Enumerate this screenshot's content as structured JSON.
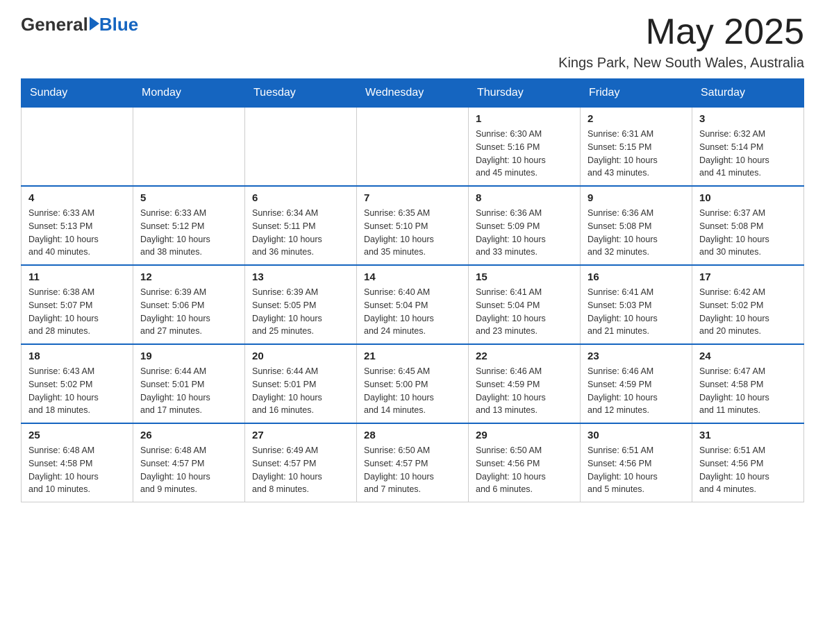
{
  "logo": {
    "text_general": "General",
    "text_blue": "Blue"
  },
  "header": {
    "month_title": "May 2025",
    "location": "Kings Park, New South Wales, Australia"
  },
  "days_of_week": [
    "Sunday",
    "Monday",
    "Tuesday",
    "Wednesday",
    "Thursday",
    "Friday",
    "Saturday"
  ],
  "weeks": [
    [
      {
        "day": "",
        "info": ""
      },
      {
        "day": "",
        "info": ""
      },
      {
        "day": "",
        "info": ""
      },
      {
        "day": "",
        "info": ""
      },
      {
        "day": "1",
        "info": "Sunrise: 6:30 AM\nSunset: 5:16 PM\nDaylight: 10 hours\nand 45 minutes."
      },
      {
        "day": "2",
        "info": "Sunrise: 6:31 AM\nSunset: 5:15 PM\nDaylight: 10 hours\nand 43 minutes."
      },
      {
        "day": "3",
        "info": "Sunrise: 6:32 AM\nSunset: 5:14 PM\nDaylight: 10 hours\nand 41 minutes."
      }
    ],
    [
      {
        "day": "4",
        "info": "Sunrise: 6:33 AM\nSunset: 5:13 PM\nDaylight: 10 hours\nand 40 minutes."
      },
      {
        "day": "5",
        "info": "Sunrise: 6:33 AM\nSunset: 5:12 PM\nDaylight: 10 hours\nand 38 minutes."
      },
      {
        "day": "6",
        "info": "Sunrise: 6:34 AM\nSunset: 5:11 PM\nDaylight: 10 hours\nand 36 minutes."
      },
      {
        "day": "7",
        "info": "Sunrise: 6:35 AM\nSunset: 5:10 PM\nDaylight: 10 hours\nand 35 minutes."
      },
      {
        "day": "8",
        "info": "Sunrise: 6:36 AM\nSunset: 5:09 PM\nDaylight: 10 hours\nand 33 minutes."
      },
      {
        "day": "9",
        "info": "Sunrise: 6:36 AM\nSunset: 5:08 PM\nDaylight: 10 hours\nand 32 minutes."
      },
      {
        "day": "10",
        "info": "Sunrise: 6:37 AM\nSunset: 5:08 PM\nDaylight: 10 hours\nand 30 minutes."
      }
    ],
    [
      {
        "day": "11",
        "info": "Sunrise: 6:38 AM\nSunset: 5:07 PM\nDaylight: 10 hours\nand 28 minutes."
      },
      {
        "day": "12",
        "info": "Sunrise: 6:39 AM\nSunset: 5:06 PM\nDaylight: 10 hours\nand 27 minutes."
      },
      {
        "day": "13",
        "info": "Sunrise: 6:39 AM\nSunset: 5:05 PM\nDaylight: 10 hours\nand 25 minutes."
      },
      {
        "day": "14",
        "info": "Sunrise: 6:40 AM\nSunset: 5:04 PM\nDaylight: 10 hours\nand 24 minutes."
      },
      {
        "day": "15",
        "info": "Sunrise: 6:41 AM\nSunset: 5:04 PM\nDaylight: 10 hours\nand 23 minutes."
      },
      {
        "day": "16",
        "info": "Sunrise: 6:41 AM\nSunset: 5:03 PM\nDaylight: 10 hours\nand 21 minutes."
      },
      {
        "day": "17",
        "info": "Sunrise: 6:42 AM\nSunset: 5:02 PM\nDaylight: 10 hours\nand 20 minutes."
      }
    ],
    [
      {
        "day": "18",
        "info": "Sunrise: 6:43 AM\nSunset: 5:02 PM\nDaylight: 10 hours\nand 18 minutes."
      },
      {
        "day": "19",
        "info": "Sunrise: 6:44 AM\nSunset: 5:01 PM\nDaylight: 10 hours\nand 17 minutes."
      },
      {
        "day": "20",
        "info": "Sunrise: 6:44 AM\nSunset: 5:01 PM\nDaylight: 10 hours\nand 16 minutes."
      },
      {
        "day": "21",
        "info": "Sunrise: 6:45 AM\nSunset: 5:00 PM\nDaylight: 10 hours\nand 14 minutes."
      },
      {
        "day": "22",
        "info": "Sunrise: 6:46 AM\nSunset: 4:59 PM\nDaylight: 10 hours\nand 13 minutes."
      },
      {
        "day": "23",
        "info": "Sunrise: 6:46 AM\nSunset: 4:59 PM\nDaylight: 10 hours\nand 12 minutes."
      },
      {
        "day": "24",
        "info": "Sunrise: 6:47 AM\nSunset: 4:58 PM\nDaylight: 10 hours\nand 11 minutes."
      }
    ],
    [
      {
        "day": "25",
        "info": "Sunrise: 6:48 AM\nSunset: 4:58 PM\nDaylight: 10 hours\nand 10 minutes."
      },
      {
        "day": "26",
        "info": "Sunrise: 6:48 AM\nSunset: 4:57 PM\nDaylight: 10 hours\nand 9 minutes."
      },
      {
        "day": "27",
        "info": "Sunrise: 6:49 AM\nSunset: 4:57 PM\nDaylight: 10 hours\nand 8 minutes."
      },
      {
        "day": "28",
        "info": "Sunrise: 6:50 AM\nSunset: 4:57 PM\nDaylight: 10 hours\nand 7 minutes."
      },
      {
        "day": "29",
        "info": "Sunrise: 6:50 AM\nSunset: 4:56 PM\nDaylight: 10 hours\nand 6 minutes."
      },
      {
        "day": "30",
        "info": "Sunrise: 6:51 AM\nSunset: 4:56 PM\nDaylight: 10 hours\nand 5 minutes."
      },
      {
        "day": "31",
        "info": "Sunrise: 6:51 AM\nSunset: 4:56 PM\nDaylight: 10 hours\nand 4 minutes."
      }
    ]
  ]
}
